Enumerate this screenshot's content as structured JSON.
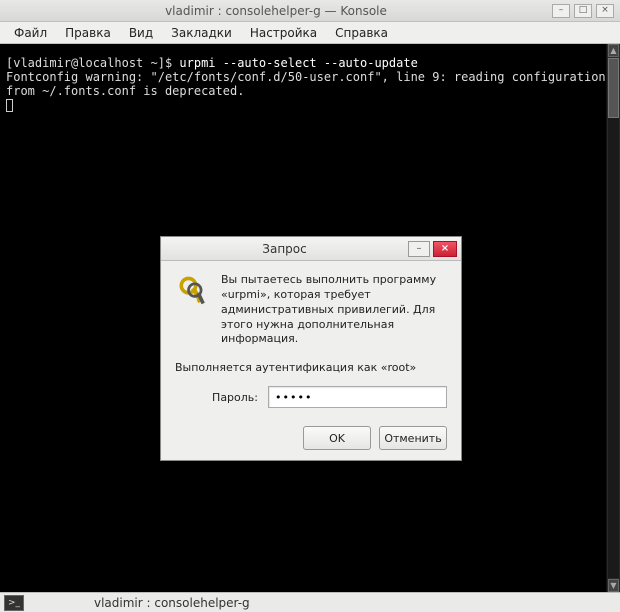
{
  "window": {
    "title": "vladimir : consolehelper-g — Konsole",
    "controls": {
      "min": "–",
      "max": "□",
      "close": "×"
    }
  },
  "menubar": [
    "Файл",
    "Правка",
    "Вид",
    "Закладки",
    "Настройка",
    "Справка"
  ],
  "terminal": {
    "prompt": "[vladimir@localhost ~]$ ",
    "command": "urpmi --auto-select --auto-update",
    "line2": "Fontconfig warning: \"/etc/fonts/conf.d/50-user.conf\", line 9: reading configurations from ~/.fonts.conf is deprecated."
  },
  "dialog": {
    "title": "Запрос",
    "message": "Вы пытаетесь выполнить программу «urpmi», которая требует административных привилегий. Для этого нужна дополнительная информация.",
    "auth_line": "Выполняется аутентификация как «root»",
    "password_label": "Пароль:",
    "password_value": "•••••",
    "ok": "OK",
    "cancel": "Отменить",
    "controls": {
      "min": "–",
      "close": "×"
    }
  },
  "taskbar": {
    "item": "vladimir : consolehelper-g"
  }
}
